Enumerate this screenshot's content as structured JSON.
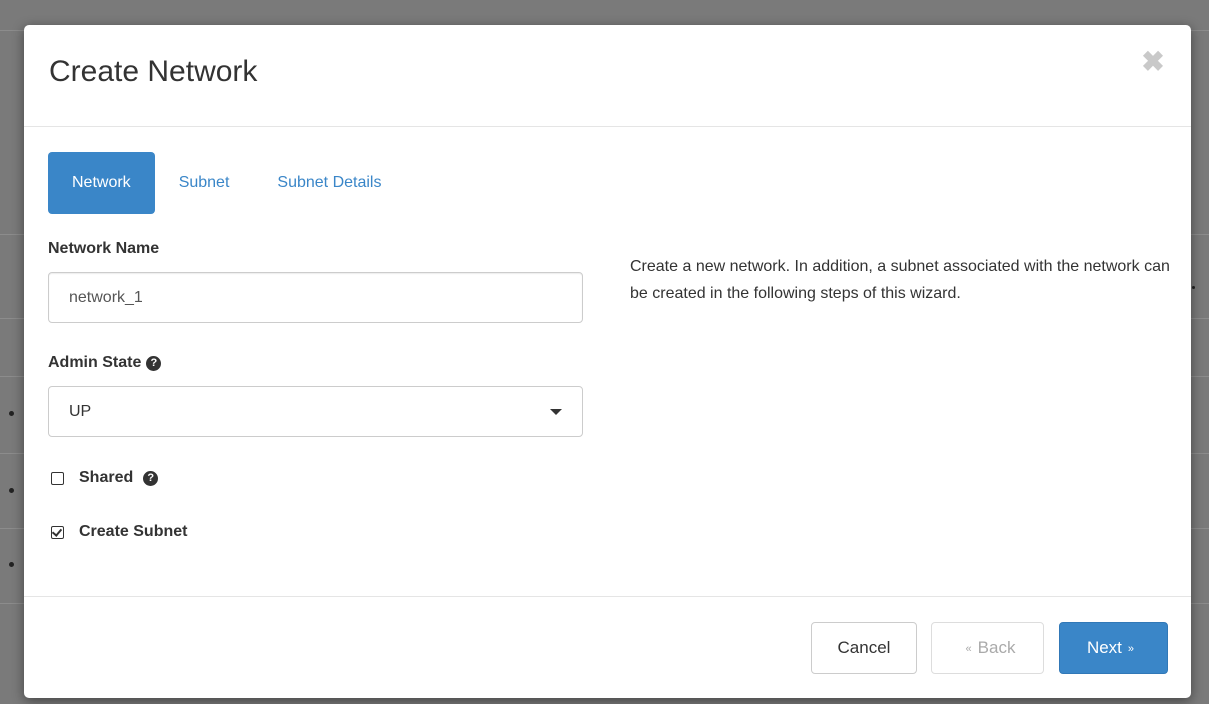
{
  "modal": {
    "title": "Create Network",
    "close_glyph": "✖"
  },
  "tabs": [
    {
      "label": "Network",
      "active": true
    },
    {
      "label": "Subnet",
      "active": false
    },
    {
      "label": "Subnet Details",
      "active": false
    }
  ],
  "form": {
    "network_name_label": "Network Name",
    "network_name_value": "network_1",
    "admin_state_label": "Admin State",
    "admin_state_value": "UP",
    "shared_label": "Shared",
    "shared_checked": false,
    "create_subnet_label": "Create Subnet",
    "create_subnet_checked": true,
    "help_glyph": "?"
  },
  "description": "Create a new network. In addition, a subnet associated with the network can be created in the following steps of this wizard.",
  "footer": {
    "cancel_label": "Cancel",
    "back_label": "Back",
    "next_label": "Next",
    "back_chevron": "«",
    "next_chevron": "»"
  },
  "colors": {
    "primary": "#3a86c8",
    "text": "#333333",
    "disabled": "#aaaaaa"
  },
  "icons": {
    "close": "close-icon",
    "help": "question-circle-icon",
    "caret": "caret-down-icon",
    "checkbox_unchecked": "checkbox-empty-icon",
    "checkbox_checked": "checkbox-checked-icon"
  }
}
